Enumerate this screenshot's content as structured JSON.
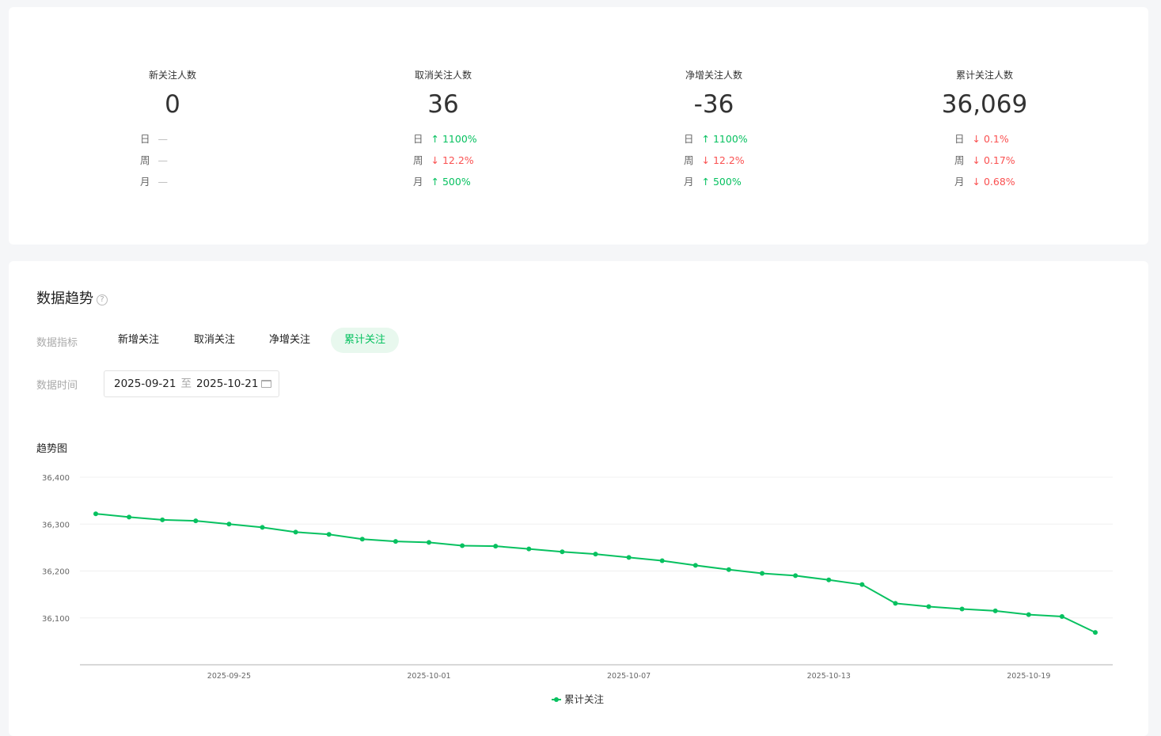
{
  "stats": [
    {
      "label": "新关注人数",
      "value": "0",
      "rows": [
        {
          "k": "日",
          "v": "—",
          "dir": "none"
        },
        {
          "k": "周",
          "v": "—",
          "dir": "none"
        },
        {
          "k": "月",
          "v": "—",
          "dir": "none"
        }
      ]
    },
    {
      "label": "取消关注人数",
      "value": "36",
      "rows": [
        {
          "k": "日",
          "v": "↑ 1100%",
          "dir": "up"
        },
        {
          "k": "周",
          "v": "↓ 12.2%",
          "dir": "down"
        },
        {
          "k": "月",
          "v": "↑ 500%",
          "dir": "up"
        }
      ]
    },
    {
      "label": "净增关注人数",
      "value": "-36",
      "rows": [
        {
          "k": "日",
          "v": "↑ 1100%",
          "dir": "up"
        },
        {
          "k": "周",
          "v": "↓ 12.2%",
          "dir": "down"
        },
        {
          "k": "月",
          "v": "↑ 500%",
          "dir": "up"
        }
      ]
    },
    {
      "label": "累计关注人数",
      "value": "36,069",
      "rows": [
        {
          "k": "日",
          "v": "↓ 0.1%",
          "dir": "down"
        },
        {
          "k": "周",
          "v": "↓ 0.17%",
          "dir": "down"
        },
        {
          "k": "月",
          "v": "↓ 0.68%",
          "dir": "down"
        }
      ]
    }
  ],
  "trend": {
    "title": "数据趋势",
    "help": "?",
    "metric_label": "数据指标",
    "tabs": [
      "新增关注",
      "取消关注",
      "净增关注",
      "累计关注"
    ],
    "active_tab": 3,
    "time_label": "数据时间",
    "date_from": "2025-09-21",
    "date_sep": "至",
    "date_to": "2025-10-21",
    "chart_title": "趋势图"
  },
  "colors": {
    "accent": "#07c160",
    "down": "#fa5151"
  },
  "chart_data": {
    "type": "line",
    "x_start": "2025-09-21",
    "x_ticks": [
      "2025-09-25",
      "2025-10-01",
      "2025-10-07",
      "2025-10-13",
      "2025-10-19"
    ],
    "y_ticks": [
      "36,100",
      "36,200",
      "36,300",
      "36,400"
    ],
    "ylim": [
      36000,
      36400
    ],
    "legend": "累计关注",
    "legend_position": "bottom",
    "series": [
      {
        "name": "累计关注",
        "values": [
          36322,
          36315,
          36309,
          36307,
          36300,
          36293,
          36283,
          36278,
          36268,
          36263,
          36261,
          36254,
          36253,
          36247,
          36241,
          36236,
          36229,
          36222,
          36212,
          36203,
          36195,
          36190,
          36181,
          36171,
          36131,
          36124,
          36119,
          36115,
          36107,
          36103,
          36069
        ]
      }
    ]
  }
}
